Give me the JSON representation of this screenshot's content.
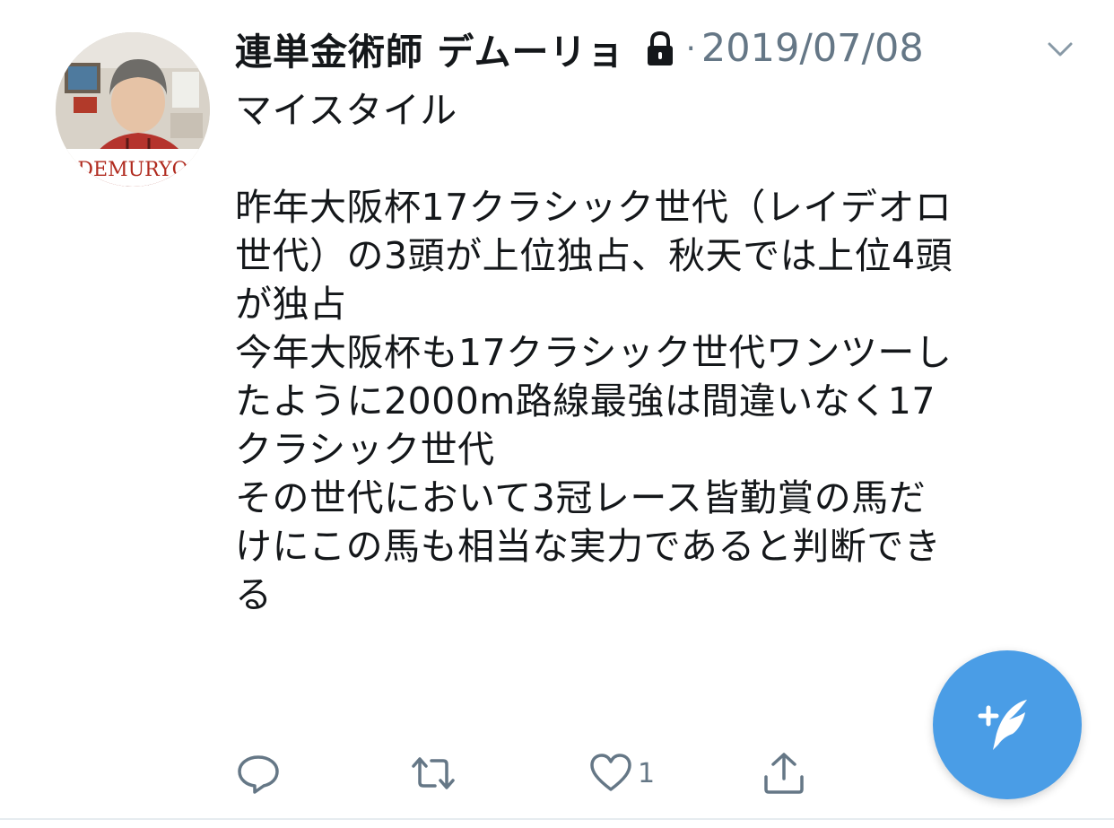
{
  "tweet": {
    "display_name": "連単金術師 デムーリョ",
    "date": "2019/07/08",
    "separator": "·",
    "avatar_text": "DEMURYO",
    "text": "マイスタイル\n\n昨年大阪杯17クラシック世代（レイデオロ\n世代）の3頭が上位独占、秋天では上位4頭\nが独占\n今年大阪杯も17クラシック世代ワンツーし\nたように2000m路線最強は間違いなく17\nクラシック世代\nその世代において3冠レース皆勤賞の馬だ\nけにこの馬も相当な実力であると判断でき\nる"
  },
  "actions": {
    "like_count": "1"
  },
  "icons": {
    "lock": "lock-icon",
    "caret": "chevron-down-icon",
    "reply": "reply-icon",
    "retweet": "retweet-icon",
    "like": "heart-icon",
    "share": "share-icon",
    "compose": "compose-tweet-icon"
  },
  "colors": {
    "accent": "#4a9de6",
    "secondary_text": "#657786",
    "primary_text": "#14171a",
    "avatar_text": "#b02a1e"
  }
}
